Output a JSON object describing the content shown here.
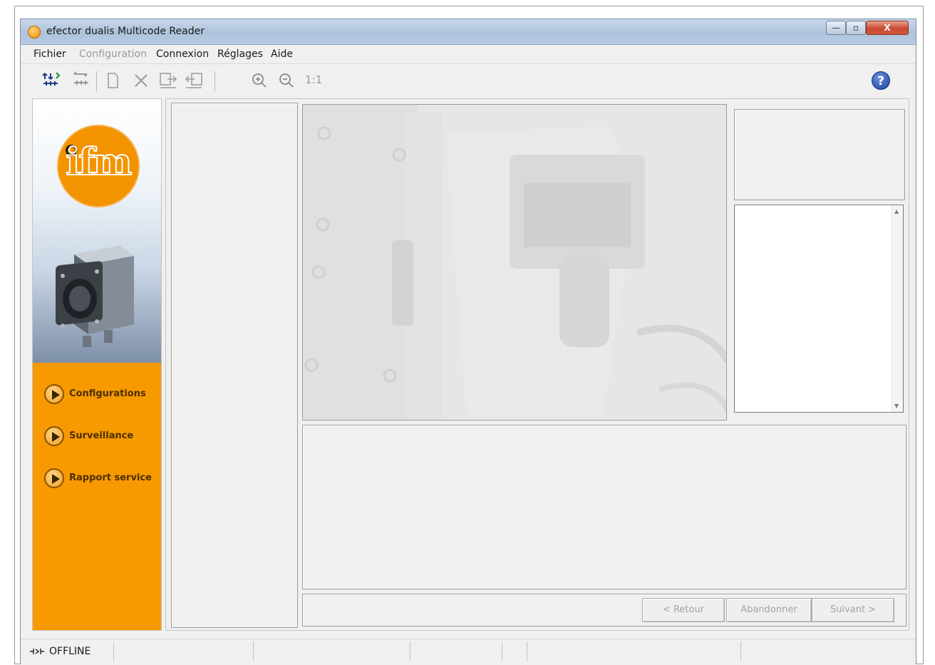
{
  "window": {
    "title": "efector dualis Multicode Reader",
    "app_icon": "ifm-app-icon",
    "controls": {
      "minimize": "—",
      "maximize": "▫",
      "close": "X"
    }
  },
  "menu": [
    {
      "label": "Fichier",
      "enabled": true
    },
    {
      "label": "Configuration",
      "enabled": false
    },
    {
      "label": "Connexion",
      "enabled": true
    },
    {
      "label": "Réglages",
      "enabled": true
    },
    {
      "label": "Aide",
      "enabled": true
    }
  ],
  "toolbar": {
    "icons": [
      "connect-icon",
      "disconnect-icon",
      "new-document-icon",
      "delete-icon",
      "upload-to-sensor-icon",
      "download-from-sensor-icon",
      "zoom-in-icon",
      "zoom-out-icon"
    ],
    "zoom_reset_label": "1:1",
    "help_icon": "help-icon",
    "help_glyph": "?"
  },
  "sidebar": {
    "logo_text": "ifm",
    "nav": [
      {
        "label": "Configurations"
      },
      {
        "label": "Surveillance"
      },
      {
        "label": "Rapport service"
      }
    ]
  },
  "wizard": {
    "back": "< Retour",
    "cancel": "Abandonner",
    "next": "Suivant >"
  },
  "status": {
    "connection": "OFFLINE",
    "icon": "connection-status-icon"
  },
  "colors": {
    "accent_orange": "#f79900",
    "title_blue": "#b8cbe3",
    "panel_bg": "#f0f0f0"
  }
}
